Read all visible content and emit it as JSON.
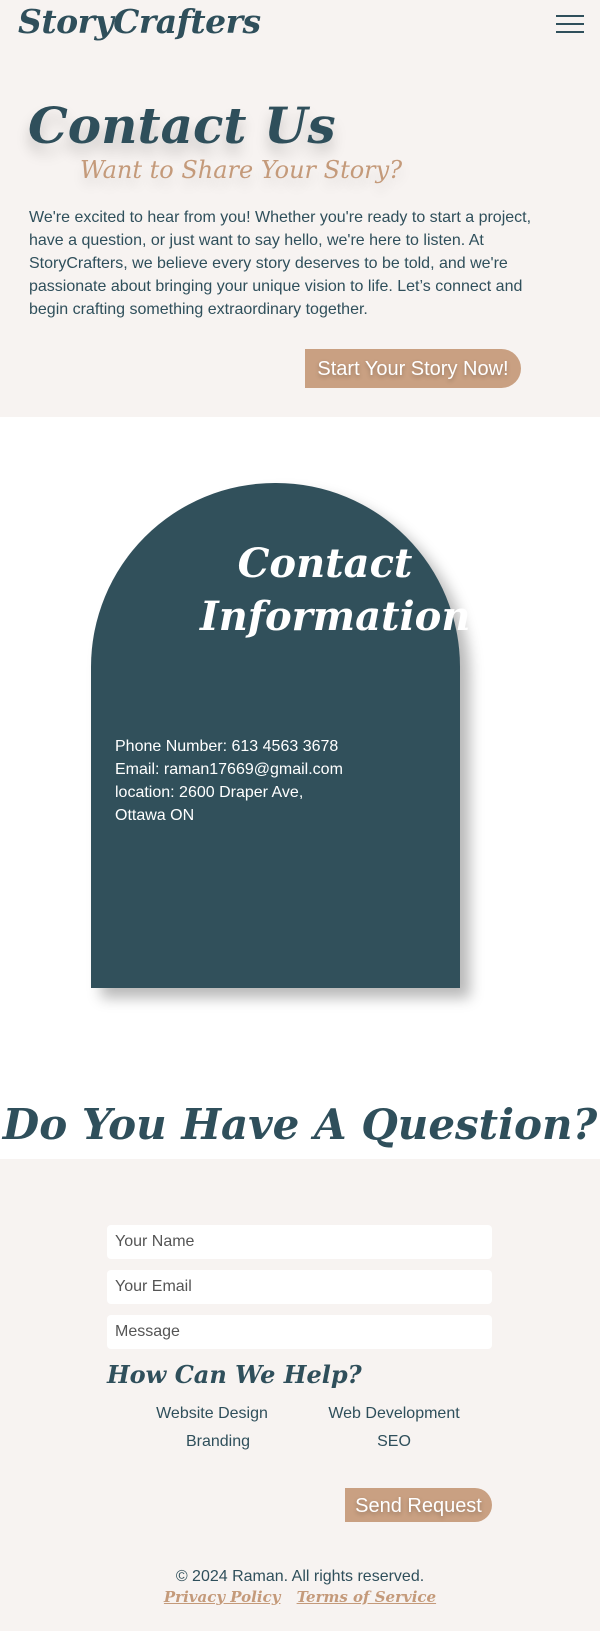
{
  "header": {
    "logo": "StoryCrafters",
    "menu_icon": "hamburger-menu-icon"
  },
  "hero": {
    "title": "Contact Us",
    "subtitle": "Want to Share Your Story?",
    "text": "We're excited to hear from you! Whether you're ready to start a project, have a question, or just want to say hello, we're here to listen. At StoryCrafters, we believe every story deserves to be told, and we're passionate about bringing your unique vision to life. Let’s connect and begin crafting something extraordinary together.",
    "cta_label": "Start Your Story Now!"
  },
  "contact": {
    "title_line1": "Contact",
    "title_line2": "Information",
    "phone": "Phone Number: 613 4563 3678",
    "email": "Email: raman17669@gmail.com",
    "location_line1": "location: 2600 Draper Ave,",
    "location_line2": "Ottawa ON"
  },
  "question": {
    "title": "Do You Have A Question?"
  },
  "form": {
    "name_placeholder": "Your Name",
    "email_placeholder": "Your Email",
    "message_placeholder": "Message",
    "help_title": "How Can We Help?",
    "options": [
      "Website Design",
      "Web Development",
      "Branding",
      "SEO"
    ],
    "send_label": "Send Request"
  },
  "footer": {
    "copyright": "© 2024 Raman. All rights reserved.",
    "privacy": "Privacy Policy",
    "terms": "Terms of Service"
  },
  "colors": {
    "primary": "#2f4f5b",
    "accent": "#c9a082",
    "background": "#f7f3f1"
  }
}
